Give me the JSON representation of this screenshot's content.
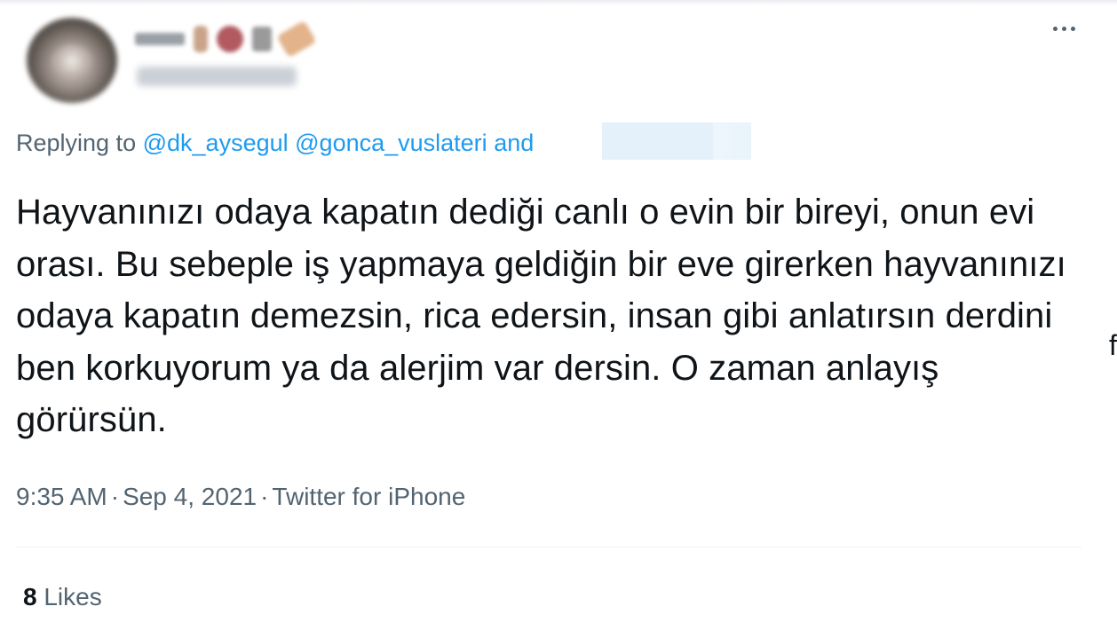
{
  "tweet": {
    "more_icon": "more-horizontal-icon",
    "reply": {
      "prefix": "Replying to",
      "mentions": [
        "@dk_aysegul",
        "@gonca_vuslateri"
      ],
      "suffix": "and"
    },
    "text": "Hayvanınızı odaya kapatın dediği canlı o evin bir bireyi, onun evi orası. Bu sebeple iş yapmaya geldiğin bir eve girerken hayvanınızı odaya kapatın demezsin, rica edersin, insan gibi anlatırsın derdini ben korkuyorum ya da alerjim var dersin. O zaman anlayış görürsün.",
    "meta": {
      "time": "9:35 AM",
      "separator": "·",
      "date": "Sep 4, 2021",
      "source": "Twitter for iPhone"
    },
    "likes": {
      "count": "8",
      "label": "Likes"
    }
  },
  "colors": {
    "text_primary": "#0f1419",
    "text_secondary": "#536471",
    "mention": "#1d9bf0",
    "divider": "#eff3f4"
  },
  "edge_glyph": "f"
}
